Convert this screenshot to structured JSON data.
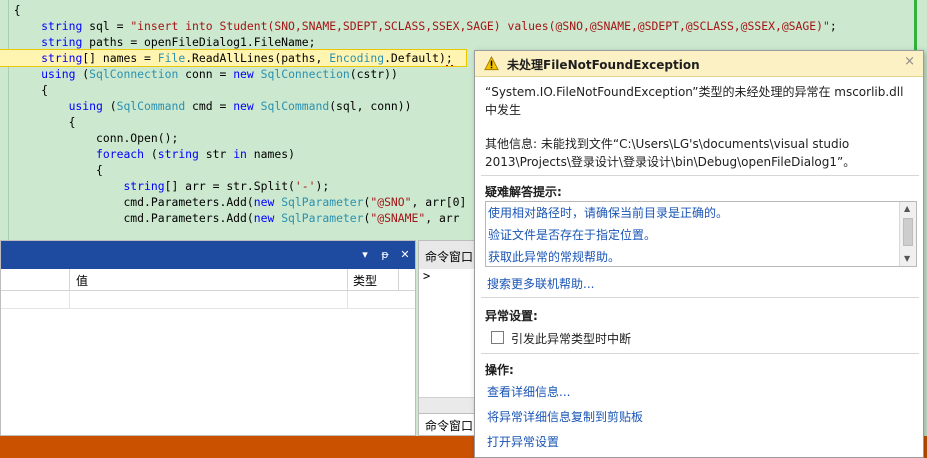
{
  "editor": {
    "lines": [
      {
        "indent": "  ",
        "tokens": [
          {
            "t": "{",
            "c": ""
          }
        ]
      },
      {
        "indent": "      ",
        "tokens": [
          {
            "t": "string",
            "c": "kw"
          },
          {
            "t": " sql = ",
            "c": ""
          },
          {
            "t": "\"insert into Student(SNO,SNAME,SDEPT,SCLASS,SSEX,SAGE) values(@SNO,@SNAME,@SDEPT,@SCLASS,@SSEX,@SAGE)\"",
            "c": "st"
          },
          {
            "t": ";",
            "c": ""
          }
        ]
      },
      {
        "indent": "      ",
        "tokens": [
          {
            "t": "string",
            "c": "kw"
          },
          {
            "t": " paths = openFileDialog1.FileName;",
            "c": ""
          }
        ]
      },
      {
        "indent": "      ",
        "hl": true,
        "tokens": [
          {
            "t": "string",
            "c": "kw"
          },
          {
            "t": "[] names = ",
            "c": ""
          },
          {
            "t": "File",
            "c": "ty"
          },
          {
            "t": ".ReadAllLines(paths, ",
            "c": ""
          },
          {
            "t": "Encoding",
            "c": "ty"
          },
          {
            "t": ".Default)",
            "c": ""
          },
          {
            "t": ";",
            "c": "err"
          }
        ]
      },
      {
        "indent": "      ",
        "tokens": [
          {
            "t": "using",
            "c": "kw"
          },
          {
            "t": " (",
            "c": ""
          },
          {
            "t": "SqlConnection",
            "c": "ty"
          },
          {
            "t": " conn = ",
            "c": ""
          },
          {
            "t": "new",
            "c": "kw"
          },
          {
            "t": " ",
            "c": ""
          },
          {
            "t": "SqlConnection",
            "c": "ty"
          },
          {
            "t": "(cstr))",
            "c": ""
          }
        ]
      },
      {
        "indent": "      ",
        "tokens": [
          {
            "t": "{",
            "c": ""
          }
        ]
      },
      {
        "indent": "          ",
        "tokens": [
          {
            "t": "using",
            "c": "kw"
          },
          {
            "t": " (",
            "c": ""
          },
          {
            "t": "SqlCommand",
            "c": "ty"
          },
          {
            "t": " cmd = ",
            "c": ""
          },
          {
            "t": "new",
            "c": "kw"
          },
          {
            "t": " ",
            "c": ""
          },
          {
            "t": "SqlCommand",
            "c": "ty"
          },
          {
            "t": "(sql, conn))",
            "c": ""
          }
        ]
      },
      {
        "indent": "          ",
        "tokens": [
          {
            "t": "{",
            "c": ""
          }
        ]
      },
      {
        "indent": "              ",
        "tokens": [
          {
            "t": "conn.Open();",
            "c": ""
          }
        ]
      },
      {
        "indent": "              ",
        "tokens": [
          {
            "t": "foreach",
            "c": "kw"
          },
          {
            "t": " (",
            "c": ""
          },
          {
            "t": "string",
            "c": "kw"
          },
          {
            "t": " str ",
            "c": ""
          },
          {
            "t": "in",
            "c": "kw"
          },
          {
            "t": " names)",
            "c": ""
          }
        ]
      },
      {
        "indent": "              ",
        "tokens": [
          {
            "t": "{",
            "c": ""
          }
        ]
      },
      {
        "indent": "                  ",
        "tokens": [
          {
            "t": "string",
            "c": "kw"
          },
          {
            "t": "[] arr = str.Split(",
            "c": ""
          },
          {
            "t": "'-'",
            "c": "st"
          },
          {
            "t": ");",
            "c": ""
          }
        ]
      },
      {
        "indent": "                  ",
        "tokens": [
          {
            "t": "cmd.Parameters.Add(",
            "c": ""
          },
          {
            "t": "new",
            "c": "kw"
          },
          {
            "t": " ",
            "c": ""
          },
          {
            "t": "SqlParameter",
            "c": "ty"
          },
          {
            "t": "(",
            "c": ""
          },
          {
            "t": "\"@SNO\"",
            "c": "st"
          },
          {
            "t": ", arr[0]",
            "c": ""
          }
        ]
      },
      {
        "indent": "                  ",
        "tokens": [
          {
            "t": "cmd.Parameters.Add(",
            "c": ""
          },
          {
            "t": "new",
            "c": "kw"
          },
          {
            "t": " ",
            "c": ""
          },
          {
            "t": "SqlParameter",
            "c": "ty"
          },
          {
            "t": "(",
            "c": ""
          },
          {
            "t": "\"@SNAME\"",
            "c": "st"
          },
          {
            "t": ", arr",
            "c": ""
          }
        ]
      }
    ]
  },
  "locals_panel": {
    "dropdown_glyph": "▾",
    "pin_glyph": "ᵽ",
    "close_glyph": "✕",
    "col_value": "值",
    "col_type": "类型"
  },
  "command_window": {
    "title": "命令窗口",
    "prompt": ">",
    "tab_label": "命令窗口"
  },
  "exception": {
    "title": "未处理FileNotFoundException",
    "close_glyph": "×",
    "message": "“System.IO.FileNotFoundException”类型的未经处理的异常在 mscorlib.dll 中发生",
    "additional_info": "其他信息: 未能找到文件“C:\\Users\\LG's\\documents\\visual studio 2013\\Projects\\登录设计\\登录设计\\bin\\Debug\\openFileDialog1”。",
    "troubleshooting_title": "疑难解答提示:",
    "tips": [
      "使用相对路径时，请确保当前目录是正确的。",
      "验证文件是否存在于指定位置。",
      "获取此异常的常规帮助。"
    ],
    "search_online": "搜索更多联机帮助...",
    "settings_title": "异常设置:",
    "break_checkbox_label": "引发此异常类型时中断",
    "actions_title": "操作:",
    "actions": [
      "查看详细信息...",
      "将异常详细信息复制到剪贴板",
      "打开异常设置"
    ]
  },
  "colors": {
    "editor_bg": "#cce8cf",
    "status_bar": "#ca5100",
    "popup_header": "#fcf1c4",
    "link": "#1a55b5"
  }
}
